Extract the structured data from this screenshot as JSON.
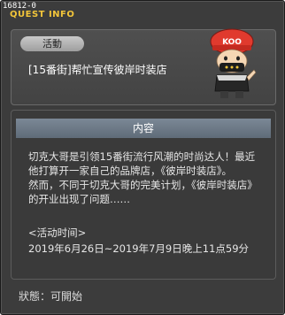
{
  "window": {
    "quest_id": "16812-0",
    "title": "QUEST INFO"
  },
  "summary": {
    "category": "活動",
    "quest_name": "[15番街]帮忙宣传彼岸时装店"
  },
  "npc": {
    "hat_text": "KOO"
  },
  "content": {
    "header": "内容",
    "lines": [
      "切克大哥是引领15番街流行风潮的时尚达人！最近",
      "他打算开一家自己的品牌店，《彼岸时装店》。",
      "然而，不同于切克大哥的完美计划，《彼岸时装店》",
      "的开业出现了问题……",
      "",
      "<活动时间>",
      "2019年6月26日~2019年7月9日晚上11点59分"
    ]
  },
  "status": {
    "text": "狀態：可開始"
  },
  "colors": {
    "title": "#f2c53a",
    "background": "#3c3c3c",
    "header_bar": "#6e7b88"
  }
}
